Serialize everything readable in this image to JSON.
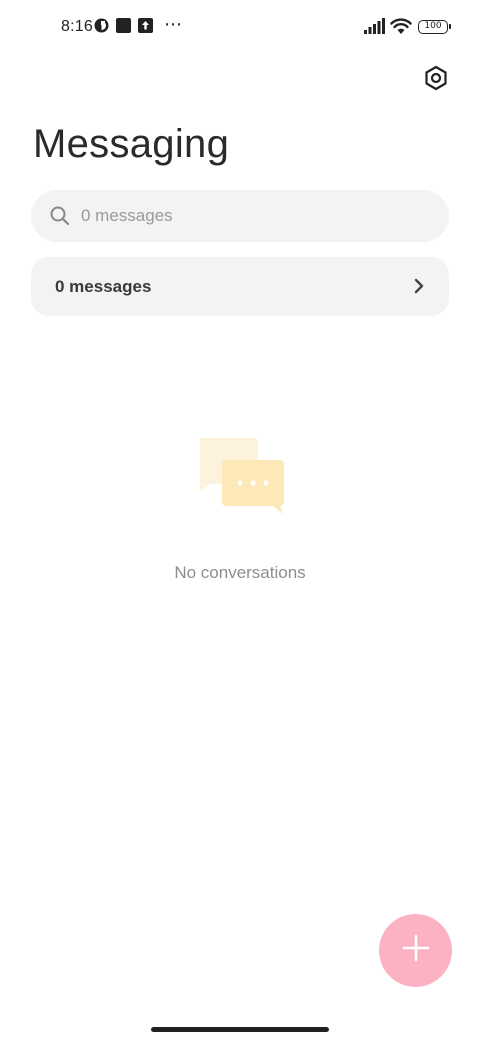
{
  "status_bar": {
    "time": "8:16",
    "battery": "100",
    "more_icon": "⋯",
    "icons": [
      "circle-half-icon",
      "square-icon",
      "upload-icon",
      "more-icon",
      "signal-icon",
      "wifi-icon",
      "battery-icon"
    ]
  },
  "header": {
    "title": "Messaging",
    "settings_icon": "gear-icon"
  },
  "search": {
    "placeholder": "0 messages",
    "value": "",
    "icon": "search-icon"
  },
  "messages_row": {
    "label": "0 messages",
    "icon": "chevron-right-icon"
  },
  "empty_state": {
    "text": "No conversations",
    "icon": "chat-bubbles-icon"
  },
  "fab": {
    "icon": "plus-icon"
  },
  "colors": {
    "background": "#ffffff",
    "card": "#f3f3f3",
    "fab": "#fdb2c4",
    "illustration_light": "#fdf3dc",
    "illustration": "#fde9b8"
  }
}
